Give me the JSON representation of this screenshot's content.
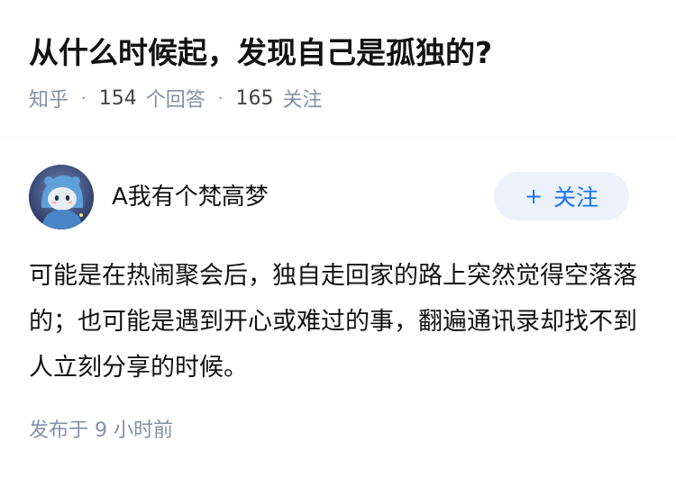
{
  "question": {
    "title": "从什么时候起，发现自己是孤独的?",
    "source": "知乎",
    "answer_count": "154",
    "answer_label": "个回答",
    "follower_count": "165",
    "follower_label": "关注"
  },
  "answer": {
    "author_name": "A我有个梵高梦",
    "follow_button_label": "关注",
    "content": "可能是在热闹聚会后，独自走回家的路上突然觉得空落落的；也可能是遇到开心或难过的事，翻遍通讯录却找不到人立刻分享的时候。",
    "published": "发布于  9 小时前"
  },
  "colors": {
    "accent": "#1772f6",
    "follow_button_bg": "#ebf2fb",
    "meta_text": "#8590a6",
    "title_text": "#121212"
  }
}
